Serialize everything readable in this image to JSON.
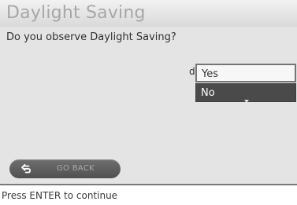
{
  "header": {
    "title": "Daylight Saving"
  },
  "main": {
    "question": "Do you observe Daylight Saving?",
    "pointer": "d",
    "options": [
      "Yes",
      "No"
    ],
    "selected_option": "Yes"
  },
  "footer": {
    "back_button_label": "GO BACK",
    "hint": "Press ENTER to continue"
  },
  "icons": {
    "back": "back-arrow-icon",
    "dropdown": "chevron-down-icon"
  },
  "colors": {
    "title_text": "#a7a7a7",
    "content_bg": "#e4e4e4",
    "selected_option_bg": "#f7f7f7",
    "option_bg": "#4a4a4a",
    "back_button_bg": "#606060"
  }
}
